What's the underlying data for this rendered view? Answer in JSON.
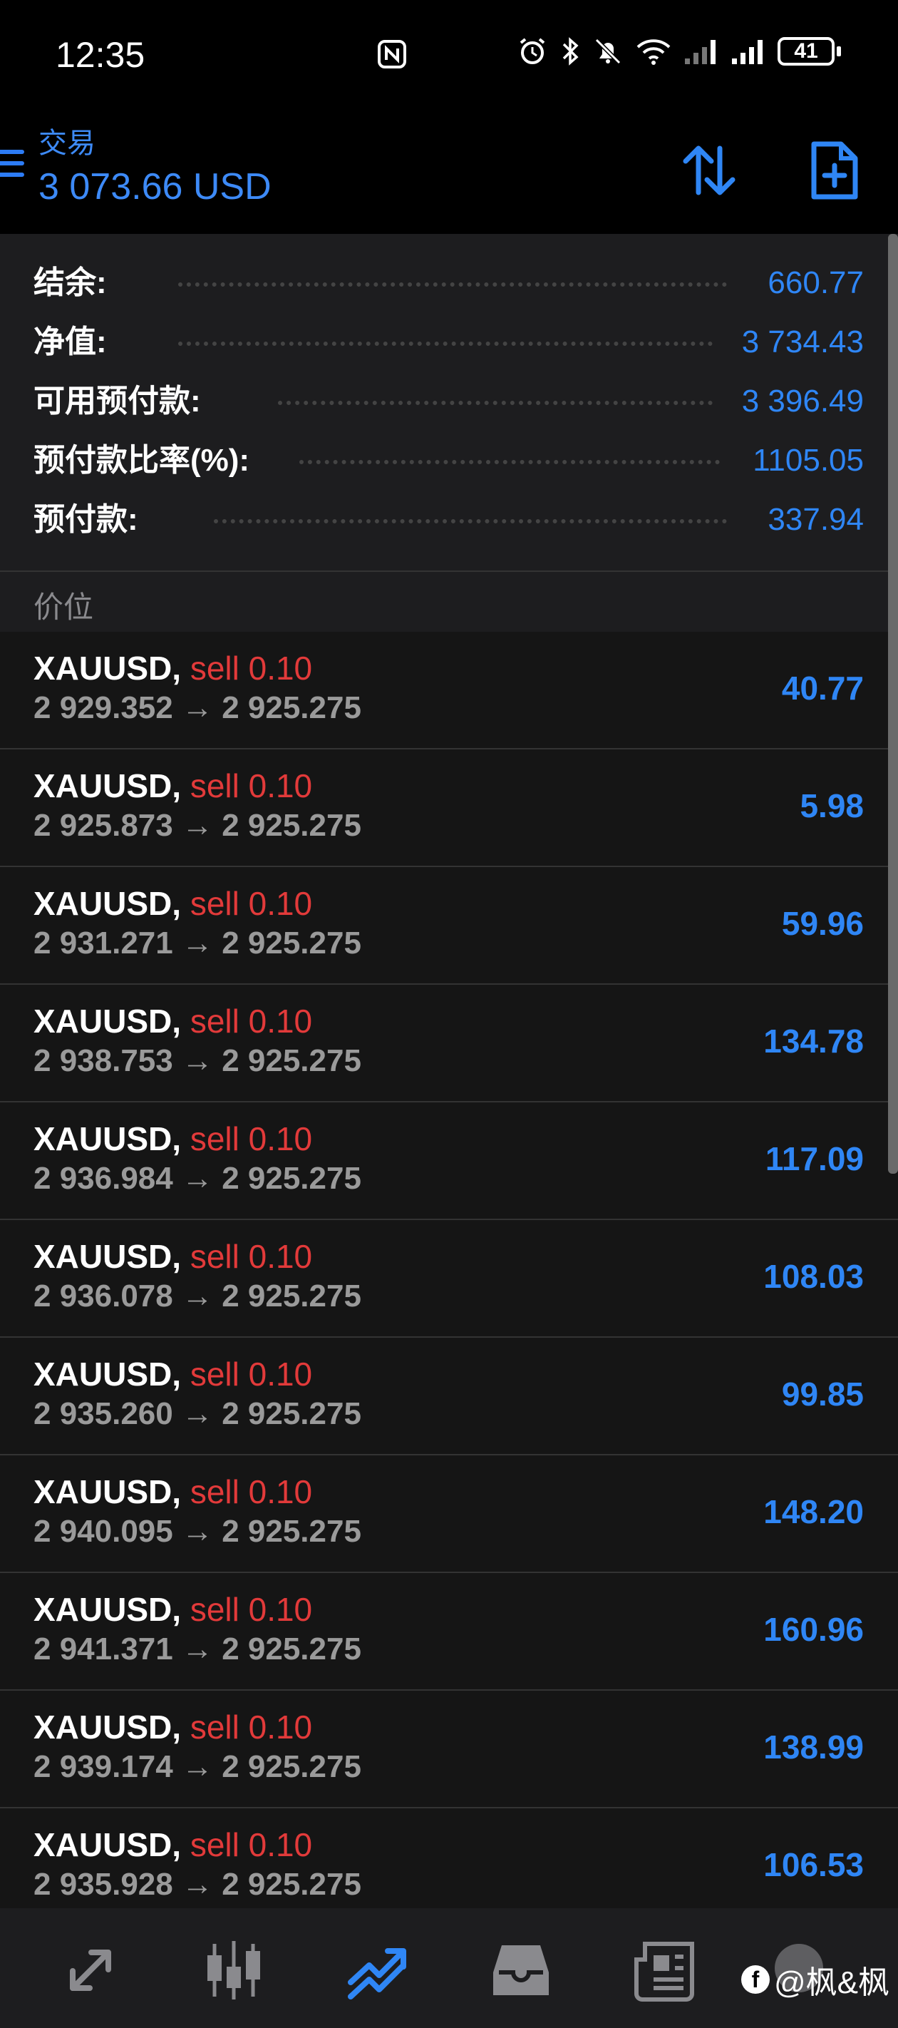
{
  "status_bar": {
    "time": "12:35",
    "battery": "41"
  },
  "header": {
    "title": "交易",
    "balance": "3 073.66 USD"
  },
  "summary": [
    {
      "label": "结余:",
      "value": "660.77"
    },
    {
      "label": "净值:",
      "value": "3 734.43"
    },
    {
      "label": "可用预付款:",
      "value": "3 396.49"
    },
    {
      "label": "预付款比率(%):",
      "value": "1105.05"
    },
    {
      "label": "预付款:",
      "value": "337.94"
    }
  ],
  "section_title": "价位",
  "positions": [
    {
      "symbol": "XAUUSD,",
      "type": "sell 0.10",
      "prices": "2 929.352 → 2 925.275",
      "profit": "40.77"
    },
    {
      "symbol": "XAUUSD,",
      "type": "sell 0.10",
      "prices": "2 925.873 → 2 925.275",
      "profit": "5.98"
    },
    {
      "symbol": "XAUUSD,",
      "type": "sell 0.10",
      "prices": "2 931.271 → 2 925.275",
      "profit": "59.96"
    },
    {
      "symbol": "XAUUSD,",
      "type": "sell 0.10",
      "prices": "2 938.753 → 2 925.275",
      "profit": "134.78"
    },
    {
      "symbol": "XAUUSD,",
      "type": "sell 0.10",
      "prices": "2 936.984 → 2 925.275",
      "profit": "117.09"
    },
    {
      "symbol": "XAUUSD,",
      "type": "sell 0.10",
      "prices": "2 936.078 → 2 925.275",
      "profit": "108.03"
    },
    {
      "symbol": "XAUUSD,",
      "type": "sell 0.10",
      "prices": "2 935.260 → 2 925.275",
      "profit": "99.85"
    },
    {
      "symbol": "XAUUSD,",
      "type": "sell 0.10",
      "prices": "2 940.095 → 2 925.275",
      "profit": "148.20"
    },
    {
      "symbol": "XAUUSD,",
      "type": "sell 0.10",
      "prices": "2 941.371 → 2 925.275",
      "profit": "160.96"
    },
    {
      "symbol": "XAUUSD,",
      "type": "sell 0.10",
      "prices": "2 939.174 → 2 925.275",
      "profit": "138.99"
    },
    {
      "symbol": "XAUUSD,",
      "type": "sell 0.10",
      "prices": "2 935.928 → 2 925.275",
      "profit": "106.53"
    }
  ],
  "bottom_nav": [
    {
      "icon": "quotes-arrows-icon",
      "active": false
    },
    {
      "icon": "candlestick-chart-icon",
      "active": false
    },
    {
      "icon": "trade-trend-icon",
      "active": true
    },
    {
      "icon": "inbox-history-icon",
      "active": false
    },
    {
      "icon": "news-icon",
      "active": false
    },
    {
      "icon": "chat-icon",
      "active": false
    }
  ],
  "watermark": {
    "text": "@枫&枫"
  },
  "colors": {
    "accent": "#2f86f5",
    "sell": "#e23a3a",
    "muted": "#9a9a9a",
    "bg": "#151515"
  }
}
